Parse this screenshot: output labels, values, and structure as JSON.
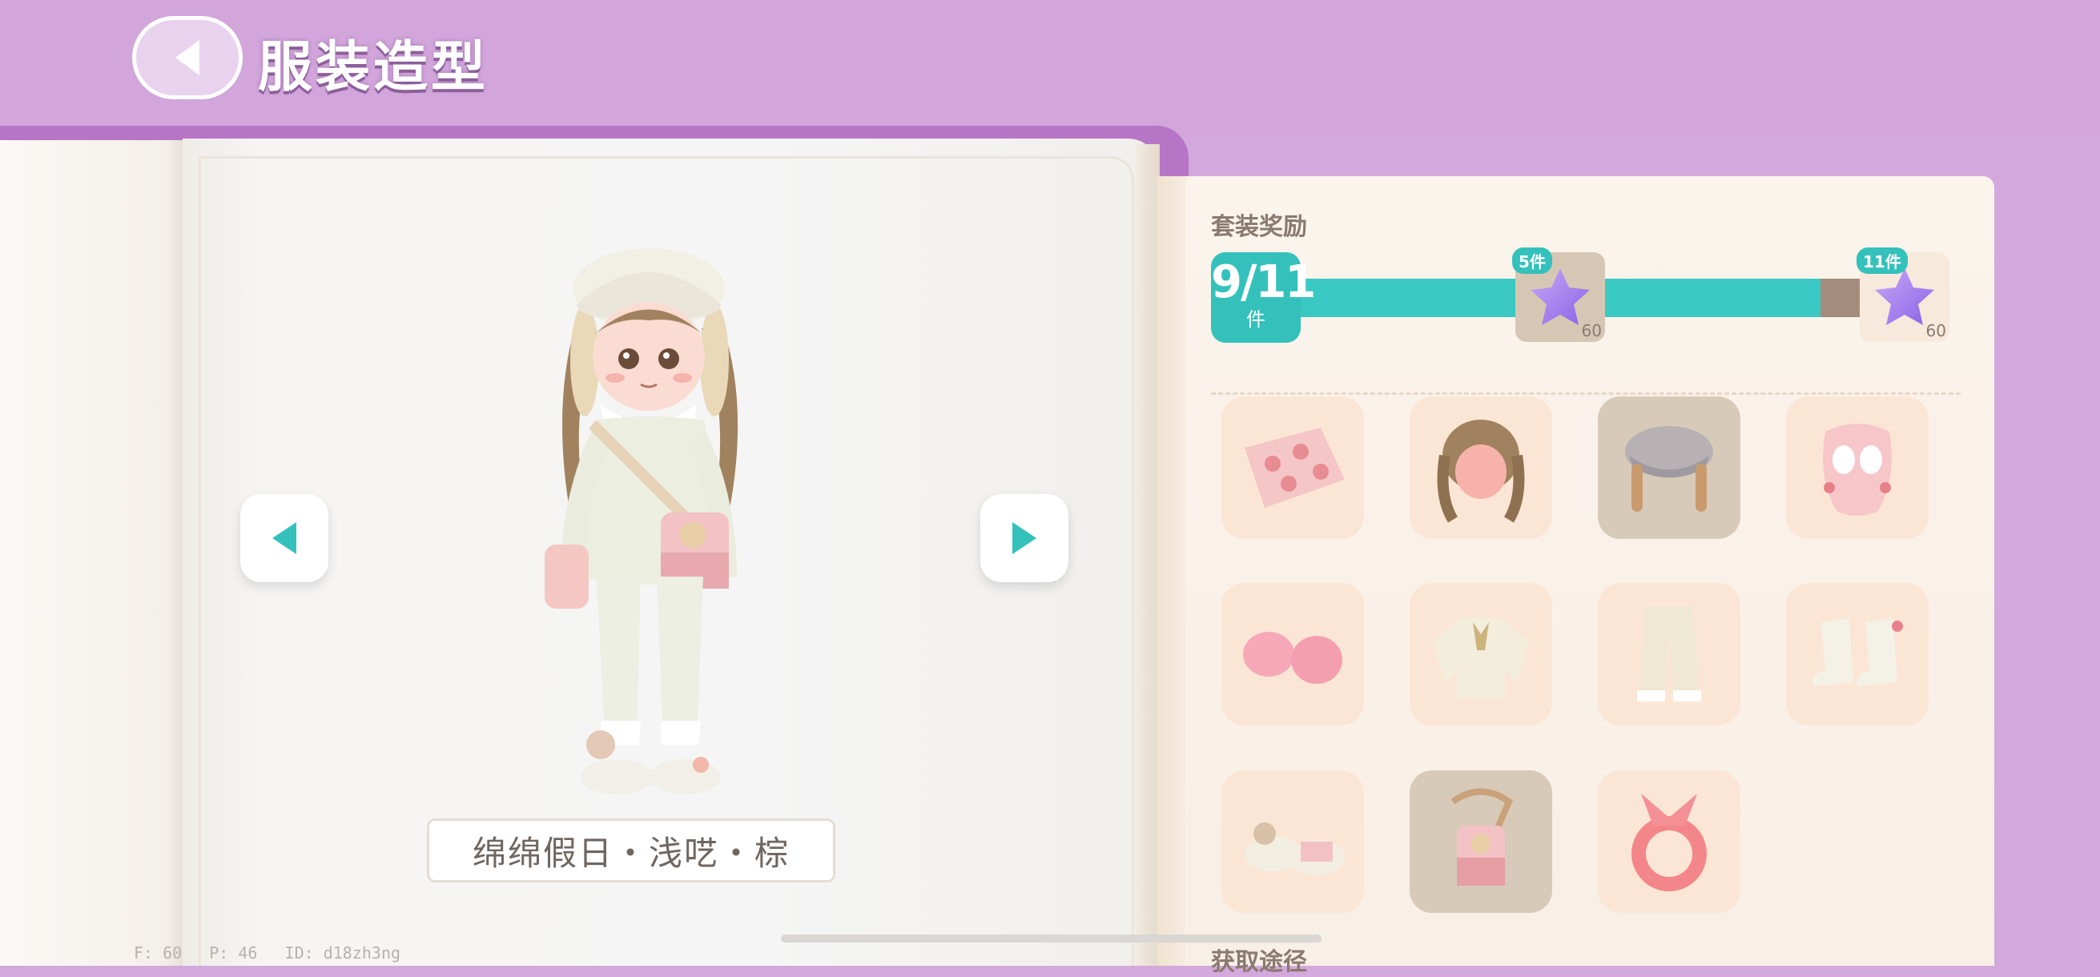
{
  "header": {
    "title": "服装造型",
    "back_icon": "chevron-left-icon"
  },
  "outfit": {
    "name": "绵绵假日・浅呓・棕"
  },
  "debug": {
    "fps": "F: 60",
    "ping": "P: 46",
    "id": "ID: d18zh3ng"
  },
  "rewards": {
    "title": "套装奖励",
    "collected": "9/11",
    "unit": "件",
    "progress": 0.93,
    "milestones": [
      {
        "tag": "5件",
        "icon": "star-icon",
        "qty": "60"
      },
      {
        "tag": "11件",
        "icon": "star-icon",
        "qty": "60"
      }
    ]
  },
  "items": [
    {
      "name": "pink floral blanket",
      "icon": "blanket-icon",
      "selected": false
    },
    {
      "name": "braided hair",
      "icon": "hair-icon",
      "selected": false
    },
    {
      "name": "bonnet hat with braids",
      "icon": "bonnet-icon",
      "selected": true
    },
    {
      "name": "face mask",
      "icon": "mask-icon",
      "selected": false
    },
    {
      "name": "pink earmuffs",
      "icon": "earmuffs-icon",
      "selected": false
    },
    {
      "name": "cream blouse",
      "icon": "blouse-icon",
      "selected": false
    },
    {
      "name": "cream pants",
      "icon": "pants-icon",
      "selected": false
    },
    {
      "name": "white boots",
      "icon": "boots-icon",
      "selected": false
    },
    {
      "name": "bunny slippers",
      "icon": "slippers-icon",
      "selected": false
    },
    {
      "name": "shoulder bag",
      "icon": "bag-icon",
      "selected": true
    },
    {
      "name": "pink scrunchie",
      "icon": "scrunchie-icon",
      "selected": false
    }
  ],
  "obtain": {
    "title": "获取途径"
  },
  "colors": {
    "accent": "#34c1bc",
    "purple": "#d2a6db",
    "progress_empty": "#a48c7d"
  }
}
